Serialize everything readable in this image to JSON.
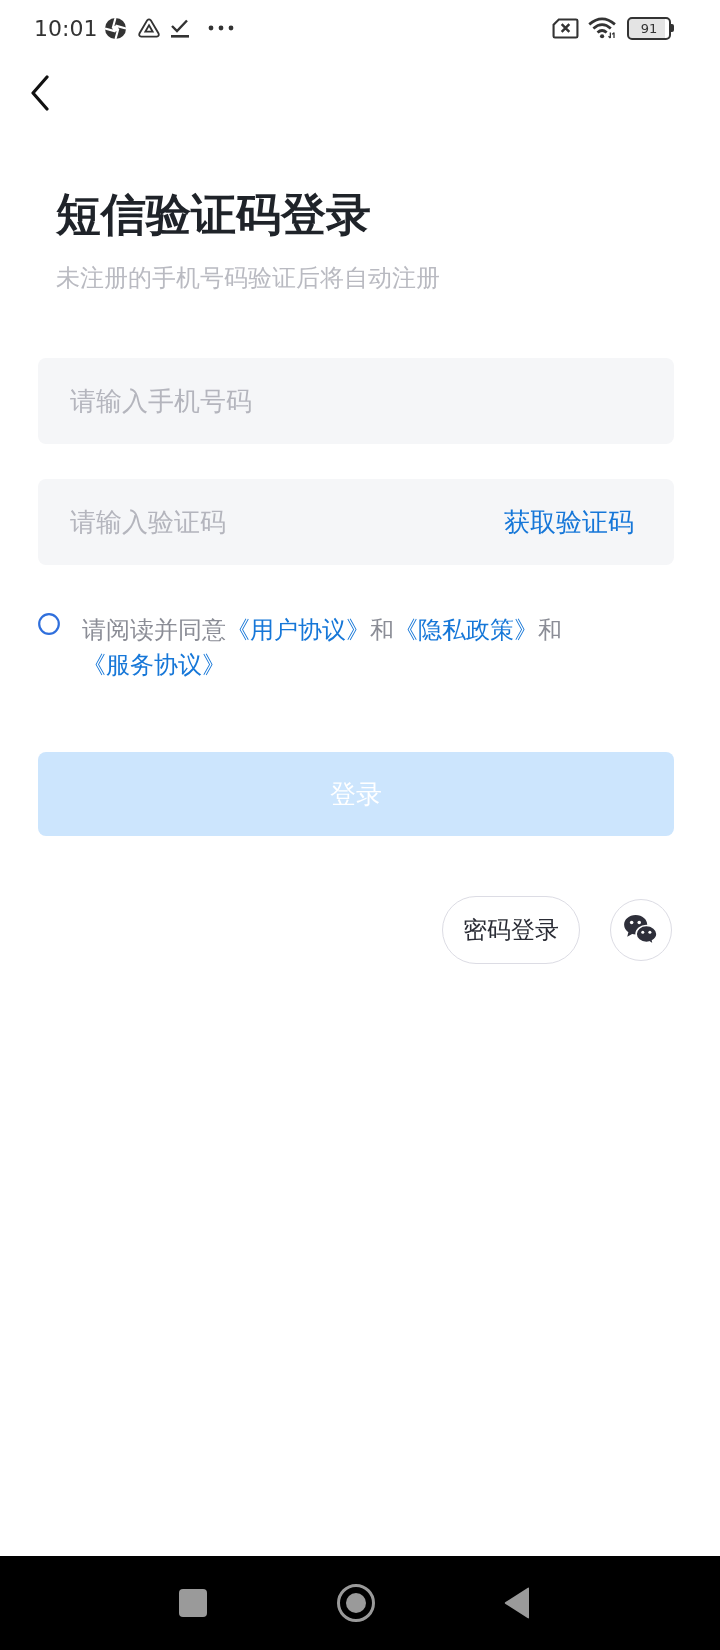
{
  "status_bar": {
    "time": "10:01",
    "battery": "91"
  },
  "header": {
    "title": "短信验证码登录",
    "subtitle": "未注册的手机号码验证后将自动注册"
  },
  "phone_field": {
    "placeholder": "请输入手机号码"
  },
  "code_field": {
    "placeholder": "请输入验证码",
    "action": "获取验证码"
  },
  "agreement": {
    "checked": false,
    "parts": [
      {
        "kind": "text",
        "text": "请阅读并同意"
      },
      {
        "kind": "link",
        "text": "《用户协议》"
      },
      {
        "kind": "text",
        "text": "和"
      },
      {
        "kind": "link",
        "text": "《隐私政策》"
      },
      {
        "kind": "text",
        "text": "和"
      },
      {
        "kind": "link",
        "text": "《服务协议》"
      }
    ]
  },
  "login_button": {
    "label": "登录",
    "disabled": true
  },
  "password_login": {
    "label": "密码登录"
  }
}
